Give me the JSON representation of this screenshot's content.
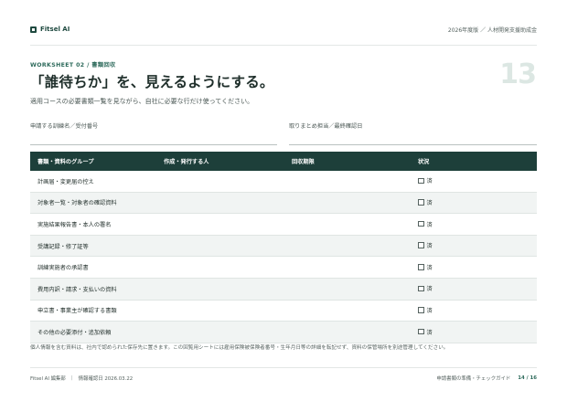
{
  "header": {
    "brand": "Fitsel AI",
    "right_text": "2026年度版 ／ 人材開発支援助成金"
  },
  "eyebrow": "WORKSHEET 02 / 書類回収",
  "title": "「誰待ちか」を、見えるようにする。",
  "subtitle": "適用コースの必要書類一覧を見ながら、自社に必要な行だけ使ってください。",
  "page_number": "13",
  "fields": {
    "left_label": "申請する訓練名／受付番号",
    "right_label": "取りまとめ担当／最終確認日"
  },
  "table": {
    "columns": [
      "書類・資料のグループ",
      "作成・発行する人",
      "回収期限",
      "状況"
    ],
    "rows": [
      {
        "group": "計画届・変更届の控え",
        "issuer": "",
        "deadline": "",
        "status": "済"
      },
      {
        "group": "対象者一覧・対象者の確認資料",
        "issuer": "",
        "deadline": "",
        "status": "済"
      },
      {
        "group": "実施結果報告書・本人の署名",
        "issuer": "",
        "deadline": "",
        "status": "済"
      },
      {
        "group": "受講記録・修了証等",
        "issuer": "",
        "deadline": "",
        "status": "済"
      },
      {
        "group": "訓練実施者の承認書",
        "issuer": "",
        "deadline": "",
        "status": "済"
      },
      {
        "group": "費用内訳・請求・支払いの資料",
        "issuer": "",
        "deadline": "",
        "status": "済"
      },
      {
        "group": "申立書・事業主が確認する書類",
        "issuer": "",
        "deadline": "",
        "status": "済"
      },
      {
        "group": "その他の必要添付・追加依頼",
        "issuer": "",
        "deadline": "",
        "status": "済"
      }
    ]
  },
  "note": "個人情報を含む資料は、社内で認められた保存先に置きます。この回覧用シートには雇用保険被保険者番号・生年月日等の詳細を転記せず、資料の保管場所を別途管理してください。",
  "footer": {
    "org": "Fitsel AI 編集部",
    "date": "情報確認日 2026.03.22",
    "guide": "申請書類の準備・チェックガイド",
    "page": "14 / 16"
  }
}
